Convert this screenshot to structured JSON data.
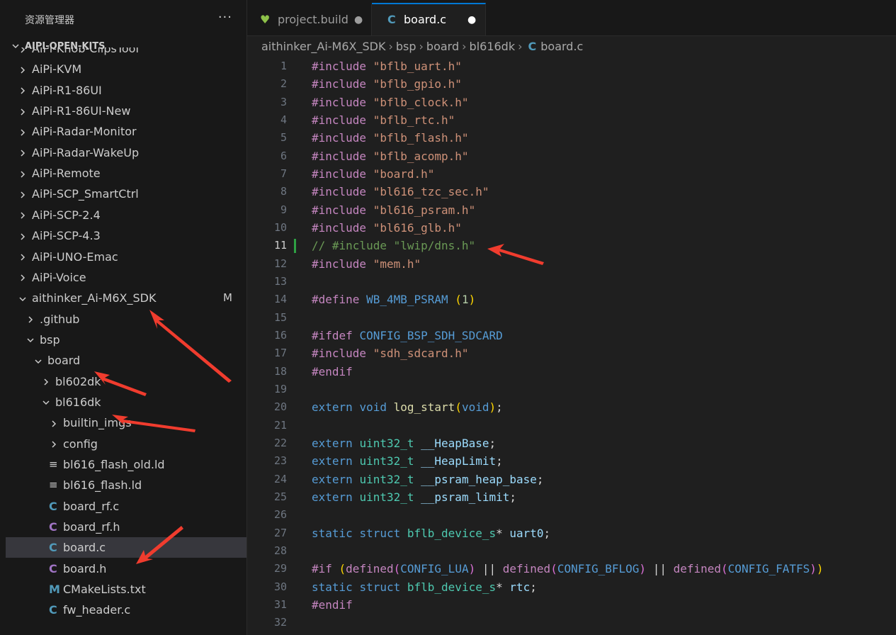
{
  "sidebar": {
    "title": "资源管理器",
    "more": "···",
    "root": {
      "label": "AIPI-OPEN-KITS"
    },
    "items": [
      {
        "label": "AiPi-Knob-ClipsTool",
        "depth": 0,
        "kind": "folder",
        "expanded": false
      },
      {
        "label": "AiPi-KVM",
        "depth": 0,
        "kind": "folder",
        "expanded": false
      },
      {
        "label": "AiPi-R1-86UI",
        "depth": 0,
        "kind": "folder",
        "expanded": false
      },
      {
        "label": "AiPi-R1-86UI-New",
        "depth": 0,
        "kind": "folder",
        "expanded": false
      },
      {
        "label": "AiPi-Radar-Monitor",
        "depth": 0,
        "kind": "folder",
        "expanded": false
      },
      {
        "label": "AiPi-Radar-WakeUp",
        "depth": 0,
        "kind": "folder",
        "expanded": false
      },
      {
        "label": "AiPi-Remote",
        "depth": 0,
        "kind": "folder",
        "expanded": false
      },
      {
        "label": "AiPi-SCP_SmartCtrl",
        "depth": 0,
        "kind": "folder",
        "expanded": false
      },
      {
        "label": "AiPi-SCP-2.4",
        "depth": 0,
        "kind": "folder",
        "expanded": false
      },
      {
        "label": "AiPi-SCP-4.3",
        "depth": 0,
        "kind": "folder",
        "expanded": false
      },
      {
        "label": "AiPi-UNO-Emac",
        "depth": 0,
        "kind": "folder",
        "expanded": false
      },
      {
        "label": "AiPi-Voice",
        "depth": 0,
        "kind": "folder",
        "expanded": false
      },
      {
        "label": "aithinker_Ai-M6X_SDK",
        "depth": 0,
        "kind": "folder",
        "expanded": true,
        "badge": "M"
      },
      {
        "label": ".github",
        "depth": 1,
        "kind": "folder",
        "expanded": false
      },
      {
        "label": "bsp",
        "depth": 1,
        "kind": "folder",
        "expanded": true
      },
      {
        "label": "board",
        "depth": 2,
        "kind": "folder",
        "expanded": true
      },
      {
        "label": "bl602dk",
        "depth": 3,
        "kind": "folder",
        "expanded": false
      },
      {
        "label": "bl616dk",
        "depth": 3,
        "kind": "folder",
        "expanded": true
      },
      {
        "label": "builtin_imgs",
        "depth": 4,
        "kind": "folder",
        "expanded": false
      },
      {
        "label": "config",
        "depth": 4,
        "kind": "folder",
        "expanded": false
      },
      {
        "label": "bl616_flash_old.ld",
        "depth": 4,
        "kind": "ld"
      },
      {
        "label": "bl616_flash.ld",
        "depth": 4,
        "kind": "ld"
      },
      {
        "label": "board_rf.c",
        "depth": 4,
        "kind": "c"
      },
      {
        "label": "board_rf.h",
        "depth": 4,
        "kind": "h"
      },
      {
        "label": "board.c",
        "depth": 4,
        "kind": "c",
        "selected": true
      },
      {
        "label": "board.h",
        "depth": 4,
        "kind": "h"
      },
      {
        "label": "CMakeLists.txt",
        "depth": 4,
        "kind": "m"
      },
      {
        "label": "fw_header.c",
        "depth": 4,
        "kind": "c"
      }
    ],
    "icons": {
      "c": "C",
      "h": "C",
      "m": "M",
      "ld": "≡"
    }
  },
  "tabs": [
    {
      "label": "project.build",
      "icon": "heart-icon",
      "glyph": "♥",
      "active": false,
      "modified": true
    },
    {
      "label": "board.c",
      "icon": "c-file-icon",
      "glyph": "C",
      "active": true,
      "modified": true
    }
  ],
  "breadcrumb": [
    "aithinker_Ai-M6X_SDK",
    "bsp",
    "board",
    "bl616dk",
    "board.c"
  ],
  "breadcrumb_icon": "C",
  "editor": {
    "current_line": 11,
    "lines": [
      [
        [
          "kw-pre",
          "#include "
        ],
        [
          "str",
          "\"bflb_uart.h\""
        ]
      ],
      [
        [
          "kw-pre",
          "#include "
        ],
        [
          "str",
          "\"bflb_gpio.h\""
        ]
      ],
      [
        [
          "kw-pre",
          "#include "
        ],
        [
          "str",
          "\"bflb_clock.h\""
        ]
      ],
      [
        [
          "kw-pre",
          "#include "
        ],
        [
          "str",
          "\"bflb_rtc.h\""
        ]
      ],
      [
        [
          "kw-pre",
          "#include "
        ],
        [
          "str",
          "\"bflb_flash.h\""
        ]
      ],
      [
        [
          "kw-pre",
          "#include "
        ],
        [
          "str",
          "\"bflb_acomp.h\""
        ]
      ],
      [
        [
          "kw-pre",
          "#include "
        ],
        [
          "str",
          "\"board.h\""
        ]
      ],
      [
        [
          "kw-pre",
          "#include "
        ],
        [
          "str",
          "\"bl616_tzc_sec.h\""
        ]
      ],
      [
        [
          "kw-pre",
          "#include "
        ],
        [
          "str",
          "\"bl616_psram.h\""
        ]
      ],
      [
        [
          "kw-pre",
          "#include "
        ],
        [
          "str",
          "\"bl616_glb.h\""
        ]
      ],
      [
        [
          "cmt",
          "// #include \"lwip/dns.h\""
        ]
      ],
      [
        [
          "kw-pre",
          "#include "
        ],
        [
          "str",
          "\"mem.h\""
        ]
      ],
      [],
      [
        [
          "kw-pre",
          "#define "
        ],
        [
          "mac",
          "WB_4MB_PSRAM "
        ],
        [
          "paren1",
          "("
        ],
        [
          "num",
          "1"
        ],
        [
          "paren1",
          ")"
        ]
      ],
      [],
      [
        [
          "kw-pre",
          "#ifdef "
        ],
        [
          "mac",
          "CONFIG_BSP_SDH_SDCARD"
        ]
      ],
      [
        [
          "kw-pre",
          "#include "
        ],
        [
          "str",
          "\"sdh_sdcard.h\""
        ]
      ],
      [
        [
          "kw-pre",
          "#endif"
        ]
      ],
      [],
      [
        [
          "kw",
          "extern "
        ],
        [
          "kw",
          "void "
        ],
        [
          "fn",
          "log_start"
        ],
        [
          "paren1",
          "("
        ],
        [
          "kw",
          "void"
        ],
        [
          "paren1",
          ")"
        ],
        [
          "plain",
          ";"
        ]
      ],
      [],
      [
        [
          "kw",
          "extern "
        ],
        [
          "ty",
          "uint32_t "
        ],
        [
          "id",
          "__HeapBase"
        ],
        [
          "plain",
          ";"
        ]
      ],
      [
        [
          "kw",
          "extern "
        ],
        [
          "ty",
          "uint32_t "
        ],
        [
          "id",
          "__HeapLimit"
        ],
        [
          "plain",
          ";"
        ]
      ],
      [
        [
          "kw",
          "extern "
        ],
        [
          "ty",
          "uint32_t "
        ],
        [
          "id",
          "__psram_heap_base"
        ],
        [
          "plain",
          ";"
        ]
      ],
      [
        [
          "kw",
          "extern "
        ],
        [
          "ty",
          "uint32_t "
        ],
        [
          "id",
          "__psram_limit"
        ],
        [
          "plain",
          ";"
        ]
      ],
      [],
      [
        [
          "kw",
          "static "
        ],
        [
          "kw",
          "struct "
        ],
        [
          "ty",
          "bflb_device_s"
        ],
        [
          "plain",
          "* "
        ],
        [
          "id",
          "uart0"
        ],
        [
          "plain",
          ";"
        ]
      ],
      [],
      [
        [
          "kw-pre",
          "#if "
        ],
        [
          "paren1",
          "("
        ],
        [
          "kw-pre",
          "defined"
        ],
        [
          "paren2",
          "("
        ],
        [
          "mac",
          "CONFIG_LUA"
        ],
        [
          "paren2",
          ")"
        ],
        [
          "plain",
          " || "
        ],
        [
          "kw-pre",
          "defined"
        ],
        [
          "paren2",
          "("
        ],
        [
          "mac",
          "CONFIG_BFLOG"
        ],
        [
          "paren2",
          ")"
        ],
        [
          "plain",
          " || "
        ],
        [
          "kw-pre",
          "defined"
        ],
        [
          "paren2",
          "("
        ],
        [
          "mac",
          "CONFIG_FATFS"
        ],
        [
          "paren2",
          ")"
        ],
        [
          "paren1",
          ")"
        ]
      ],
      [
        [
          "kw",
          "static "
        ],
        [
          "kw",
          "struct "
        ],
        [
          "ty",
          "bflb_device_s"
        ],
        [
          "plain",
          "* "
        ],
        [
          "id",
          "rtc"
        ],
        [
          "plain",
          ";"
        ]
      ],
      [
        [
          "kw-pre",
          "#endif"
        ]
      ],
      []
    ]
  },
  "colors": {
    "accent": "#0078d4",
    "annotation_arrow": "#f03c2e",
    "selection": "#37373d"
  }
}
